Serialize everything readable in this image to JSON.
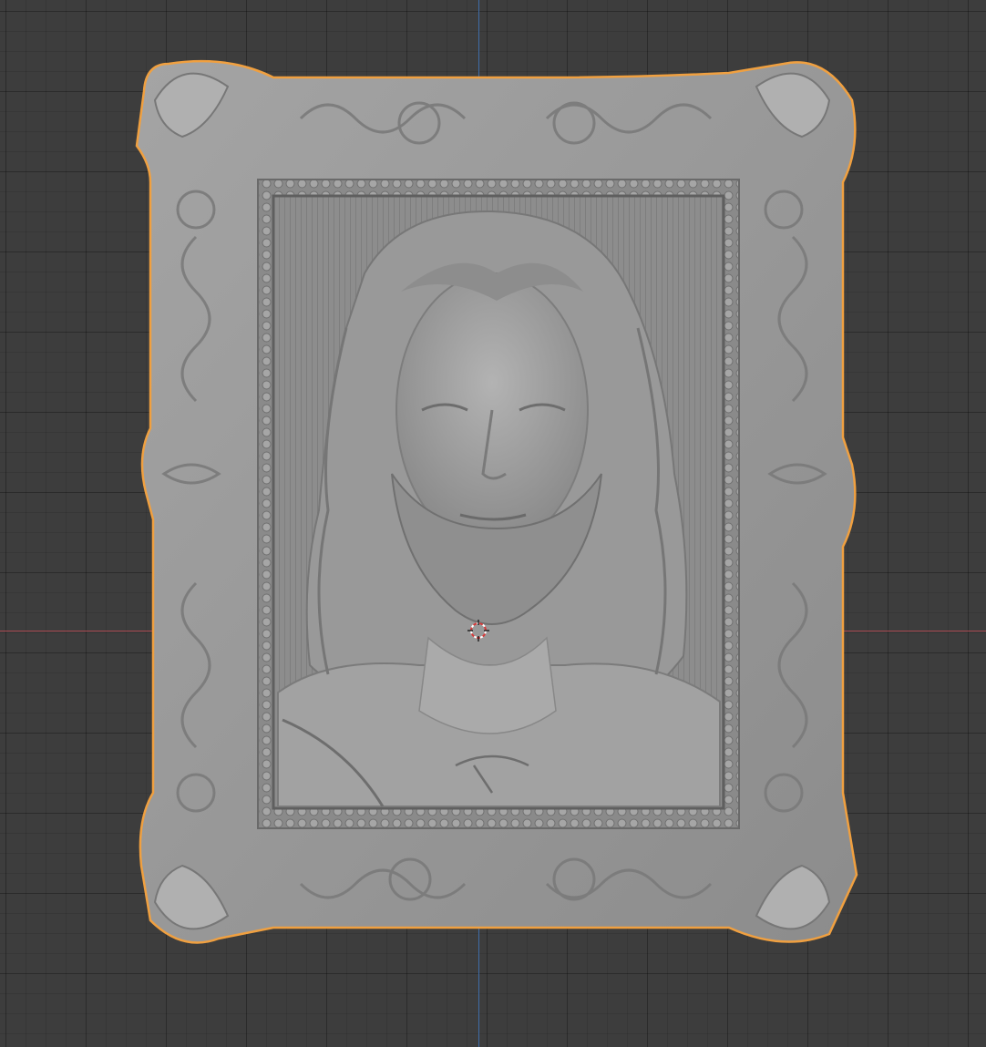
{
  "viewport": {
    "background": "#3d3d3d",
    "grid_color": "#2f2f2f",
    "axis_x_color": "#a8484f",
    "axis_y_color": "#3f6da8",
    "selection_outline_color": "#f0a040"
  },
  "object": {
    "name": "relief-frame-portrait",
    "material_color": "#9a9a9a",
    "selected": true
  },
  "cursor": {
    "icon": "3d-cursor-icon"
  }
}
